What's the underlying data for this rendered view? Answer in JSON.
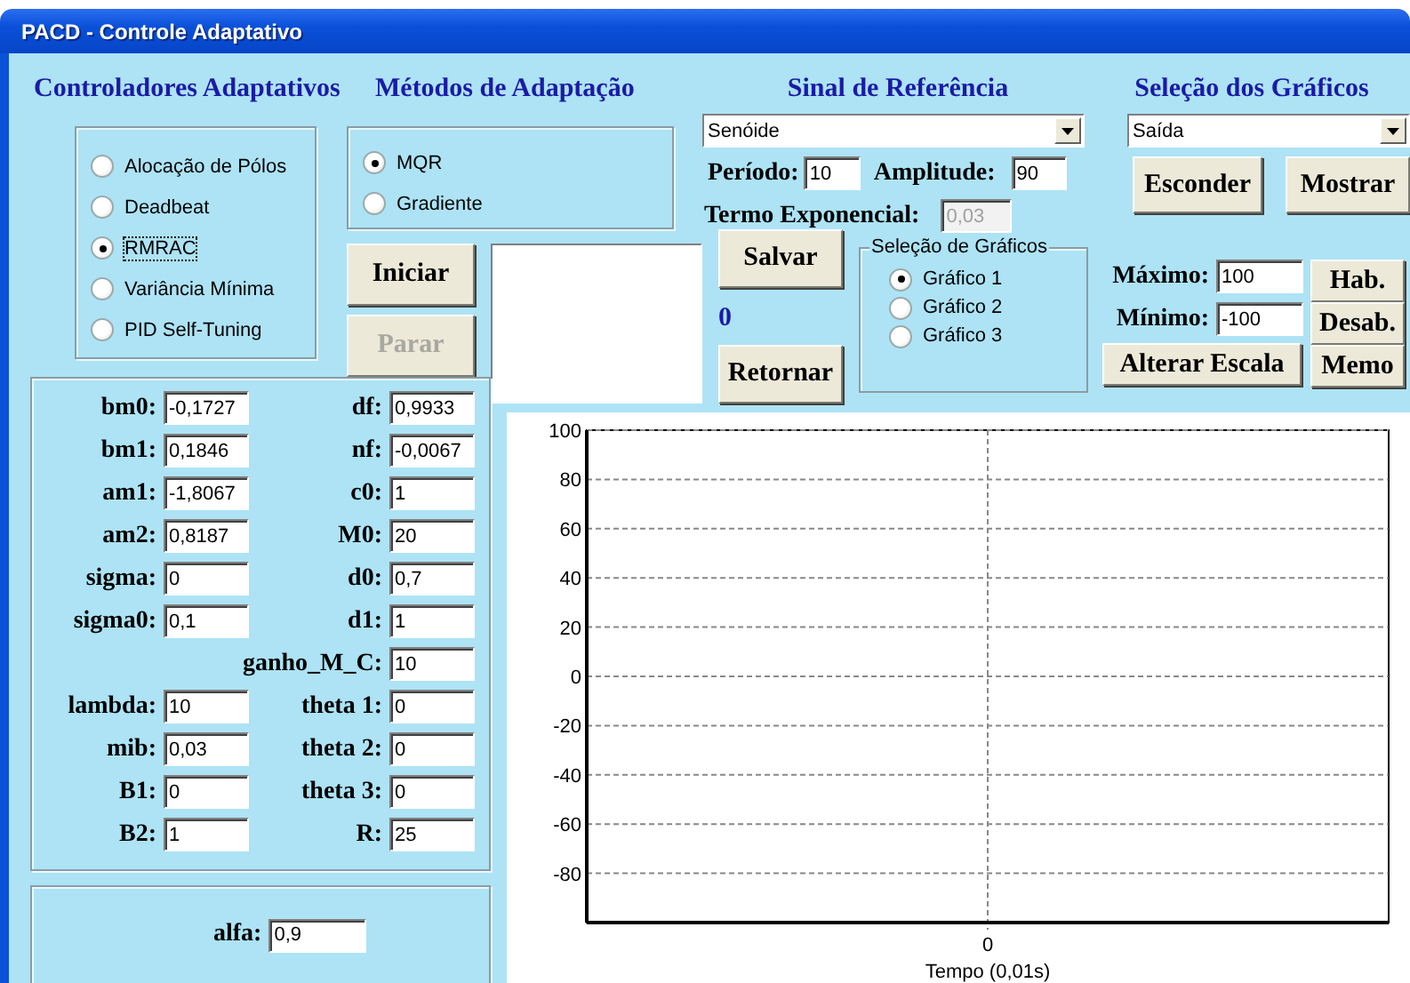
{
  "window": {
    "title": "PACD - Controle Adaptativo"
  },
  "controllers": {
    "title": "Controladores Adaptativos",
    "options": [
      {
        "label": "Alocação de Pólos",
        "selected": false,
        "focused": false
      },
      {
        "label": "Deadbeat",
        "selected": false,
        "focused": false
      },
      {
        "label": "RMRAC",
        "selected": true,
        "focused": true
      },
      {
        "label": "Variância Mínima",
        "selected": false,
        "focused": false
      },
      {
        "label": "PID Self-Tuning",
        "selected": false,
        "focused": false
      }
    ]
  },
  "methods": {
    "title": "Métodos de Adaptação",
    "options": [
      {
        "label": "MQR",
        "selected": true,
        "focused": false
      },
      {
        "label": "Gradiente",
        "selected": false,
        "focused": false
      }
    ]
  },
  "run_buttons": [
    {
      "label": "Iniciar",
      "disabled": false
    },
    {
      "label": "Parar",
      "disabled": true
    }
  ],
  "reference": {
    "title": "Sinal de Referência",
    "signal": "Senóide",
    "period": {
      "label": "Período:",
      "value": "10",
      "disabled": false
    },
    "amplitude": {
      "label": "Amplitude:",
      "value": "90",
      "disabled": false
    },
    "exponential": {
      "label": "Termo Exponencial:",
      "value": "0,03",
      "disabled": true
    }
  },
  "memory": {
    "save": "Salvar",
    "counter": "0",
    "back": "Retornar"
  },
  "graph_frame": {
    "title": "Seleção de Gráficos",
    "options": [
      {
        "label": "Gráfico 1",
        "selected": true,
        "focused": false
      },
      {
        "label": "Gráfico 2",
        "selected": false,
        "focused": false
      },
      {
        "label": "Gráfico 3",
        "selected": false,
        "focused": false
      }
    ]
  },
  "graphs": {
    "title": "Seleção dos Gráficos",
    "selection": "Saída",
    "buttons": [
      "Esconder",
      "Mostrar"
    ]
  },
  "scale": {
    "maximum": {
      "label": "Máximo:",
      "value": "100",
      "disabled": false
    },
    "minimum": {
      "label": "Mínimo:",
      "value": "-100",
      "disabled": false
    },
    "apply": "Alterar Escala",
    "side_buttons": [
      "Hab.",
      "Desab.",
      "Memo"
    ]
  },
  "parameters": [
    [
      {
        "label": "bm0:",
        "value": "-0,1727"
      },
      {
        "label": "df:",
        "value": "0,9933"
      }
    ],
    [
      {
        "label": "bm1:",
        "value": "0,1846"
      },
      {
        "label": "nf:",
        "value": "-0,0067"
      }
    ],
    [
      {
        "label": "am1:",
        "value": "-1,8067"
      },
      {
        "label": "c0:",
        "value": "1"
      }
    ],
    [
      {
        "label": "am2:",
        "value": "0,8187"
      },
      {
        "label": "M0:",
        "value": "20"
      }
    ],
    [
      {
        "label": "sigma:",
        "value": "0"
      },
      {
        "label": "d0:",
        "value": "0,7"
      }
    ],
    [
      {
        "label": "sigma0:",
        "value": "0,1"
      },
      {
        "label": "d1:",
        "value": "1"
      }
    ],
    [
      {
        "label": "ganho_M_C:",
        "value": "10"
      }
    ],
    [
      {
        "label": "lambda:",
        "value": "10"
      },
      {
        "label": "theta 1:",
        "value": "0"
      }
    ],
    [
      {
        "label": "mib:",
        "value": "0,03"
      },
      {
        "label": "theta 2:",
        "value": "0"
      }
    ],
    [
      {
        "label": "B1:",
        "value": "0"
      },
      {
        "label": "theta 3:",
        "value": "0"
      }
    ],
    [
      {
        "label": "B2:",
        "value": "1"
      },
      {
        "label": "R:",
        "value": "25"
      }
    ]
  ],
  "alfa": {
    "label": "alfa:",
    "value": "0,9"
  },
  "chart": {
    "y_labels": [
      "100",
      "80",
      "60",
      "40",
      "20",
      "0",
      "-20",
      "-40",
      "-60",
      "-80"
    ],
    "x_labels": [
      "0"
    ],
    "x_title": "Tempo (0,01s)"
  }
}
